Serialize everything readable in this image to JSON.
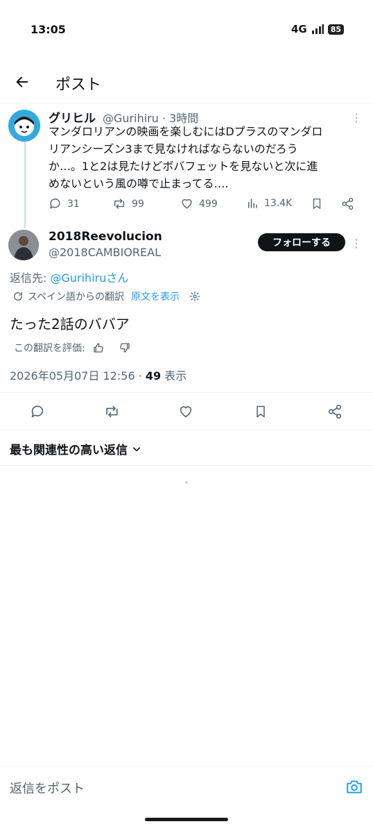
{
  "status_bar": {
    "time": "13:05",
    "network": "4G",
    "battery": "85"
  },
  "header": {
    "title": "ポスト"
  },
  "parent_post": {
    "name": "グリヒル",
    "meta": "@Gurihiru · 3時間",
    "text_lines": [
      "マンダロリアンの映画を楽しむにはDプラスのマンダロ",
      "リアンシーズン3まで見なければならないのだろう",
      "か…。1と2は見たけどボバフェットを見ないと次に進",
      "めないという風の噂で止まってる…."
    ],
    "replies": "31",
    "reposts": "99",
    "likes": "499",
    "views": "13.4K"
  },
  "post": {
    "name": "2018Reevolucion",
    "handle": "@2018CAMBIOREAL",
    "follow_label": "フォローする",
    "reply_to_prefix": "返信先: ",
    "reply_to_user": "@Gurihiruさん",
    "translated_from": "スペイン語からの翻訳",
    "show_original": "原文を表示",
    "text": "たった2話のババア",
    "rate_translation": "この翻訳を評価:",
    "timestamp": "2026年05月07日 12:56 · ",
    "view_count": "49",
    "views_label": " 表示"
  },
  "replies_sort": {
    "label": "最も関連性の高い返信"
  },
  "composer": {
    "placeholder": "返信をポスト"
  },
  "colors": {
    "accent": "#1d9bf0",
    "text": "#0f1419",
    "muted": "#536471",
    "divider": "#eff3f4",
    "follow_bg": "#0f1419"
  },
  "icons": [
    "back-arrow-icon",
    "more-icon",
    "reply-icon",
    "repost-icon",
    "like-icon",
    "views-icon",
    "bookmark-icon",
    "share-icon",
    "translate-icon",
    "gear-icon",
    "thumbs-up-icon",
    "thumbs-down-icon",
    "chevron-down-icon",
    "camera-icon"
  ]
}
